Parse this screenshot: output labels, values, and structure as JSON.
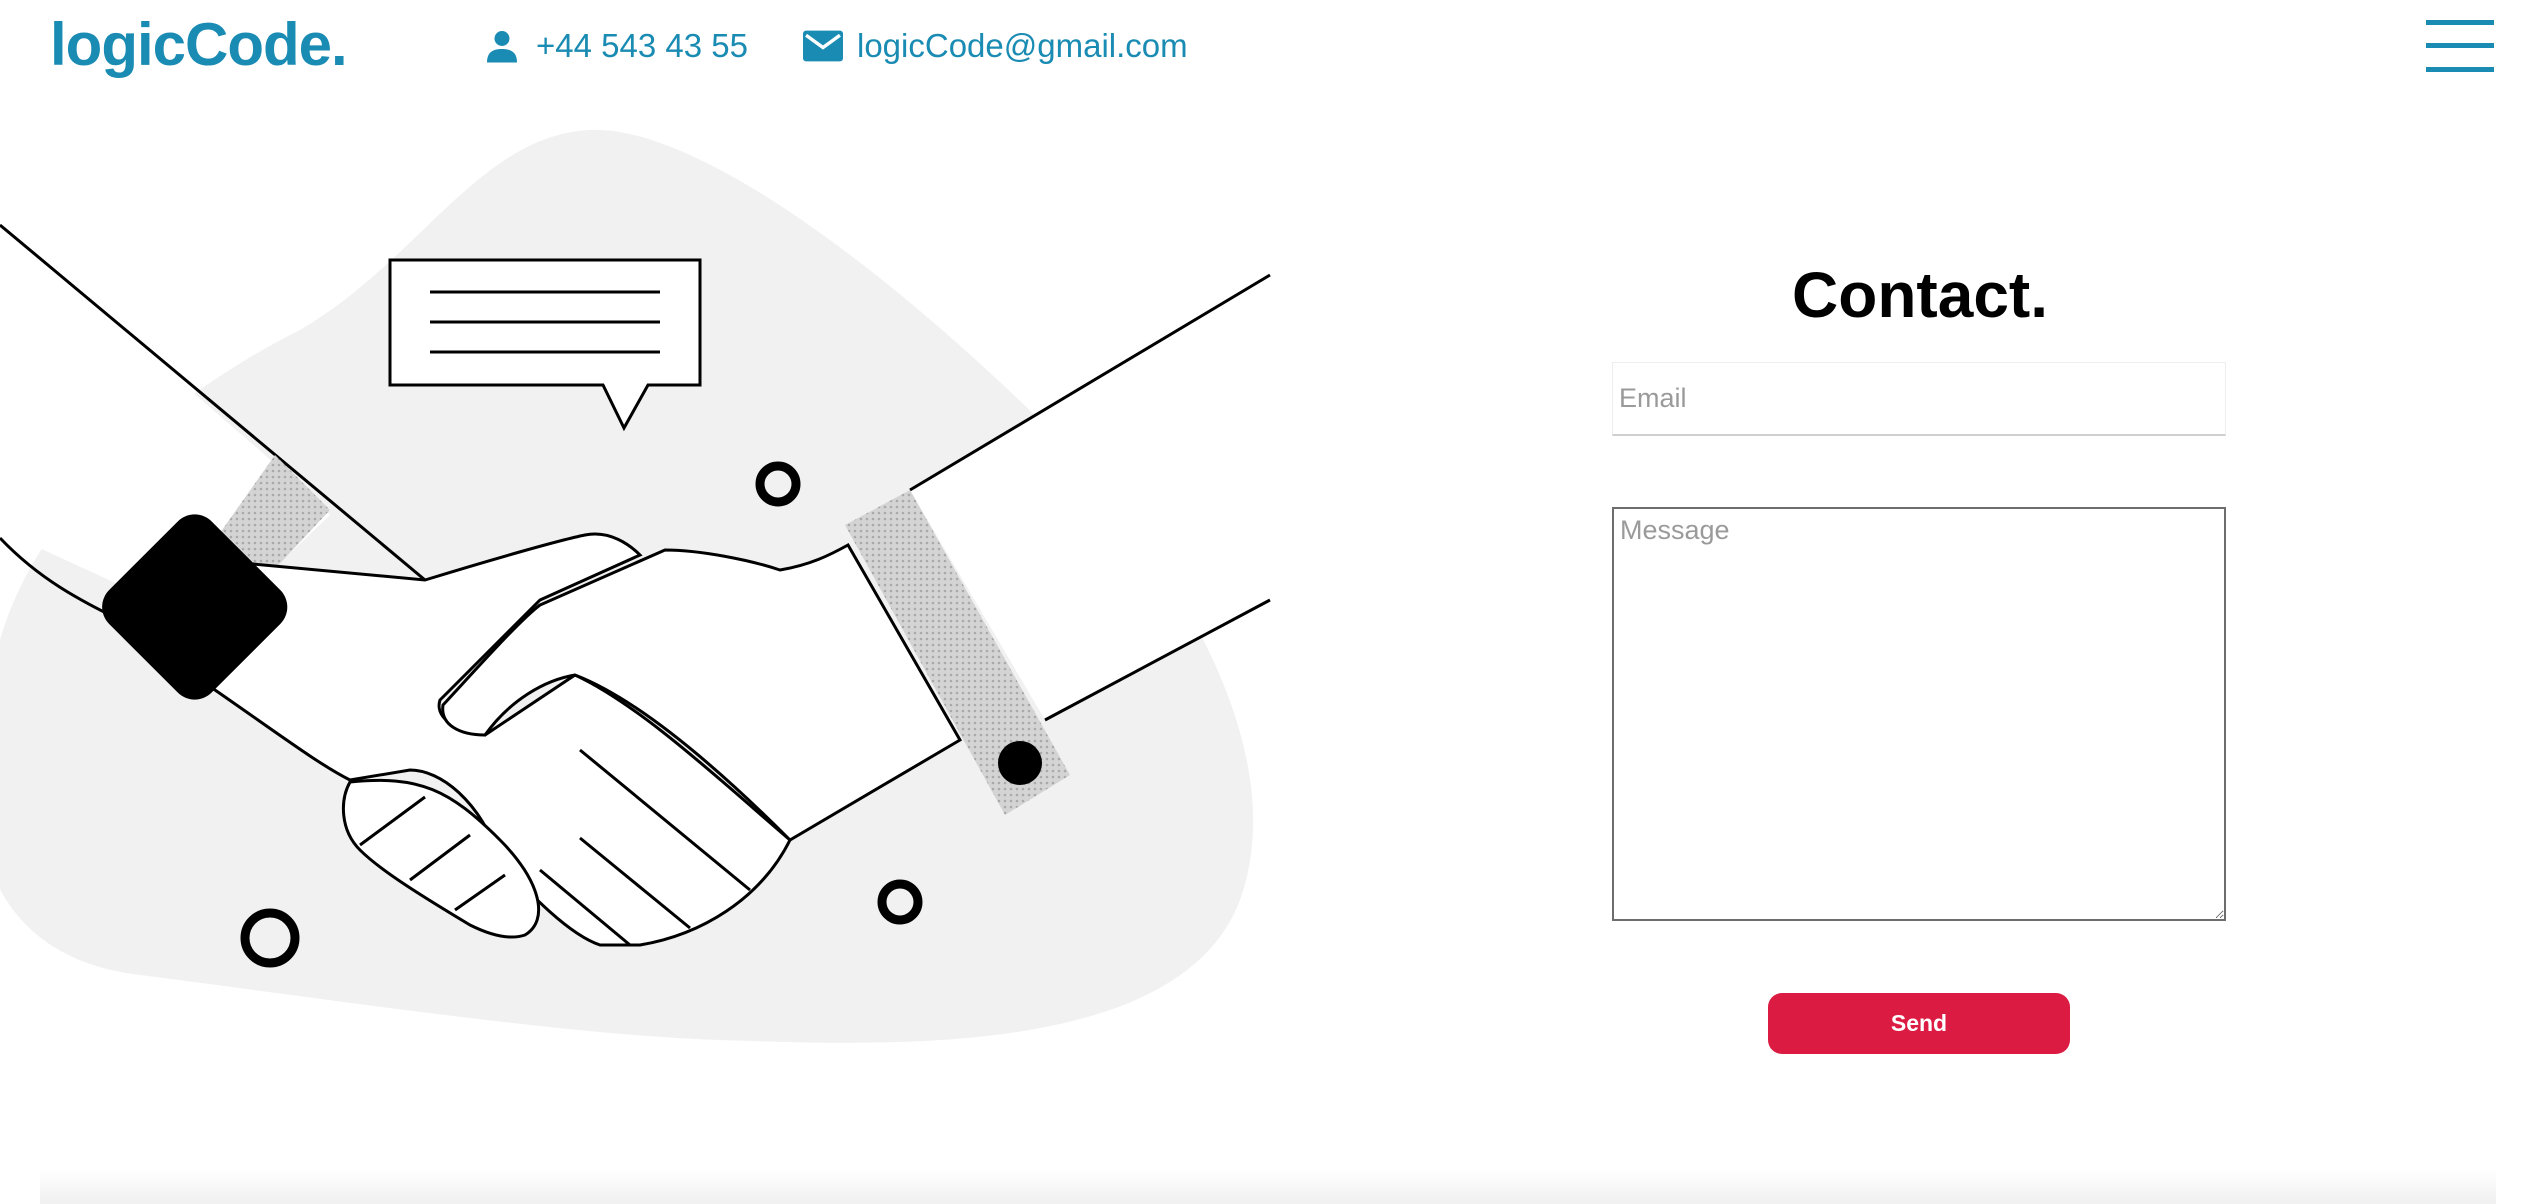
{
  "header": {
    "logo": "logicCode.",
    "phone": "+44 543 43 55",
    "email": "logicCode@gmail.com",
    "phone_icon": "person-icon",
    "email_icon": "envelope-icon",
    "menu_icon": "hamburger-menu-icon"
  },
  "form": {
    "title": "Contact.",
    "email_placeholder": "Email",
    "email_value": "",
    "message_placeholder": "Message",
    "message_value": "",
    "send_label": "Send"
  },
  "illustration": {
    "subject": "handshake-illustration"
  },
  "colors": {
    "brand": "#1a8bb2",
    "button": "#dc1b43",
    "blob": "#f1f1f1"
  }
}
